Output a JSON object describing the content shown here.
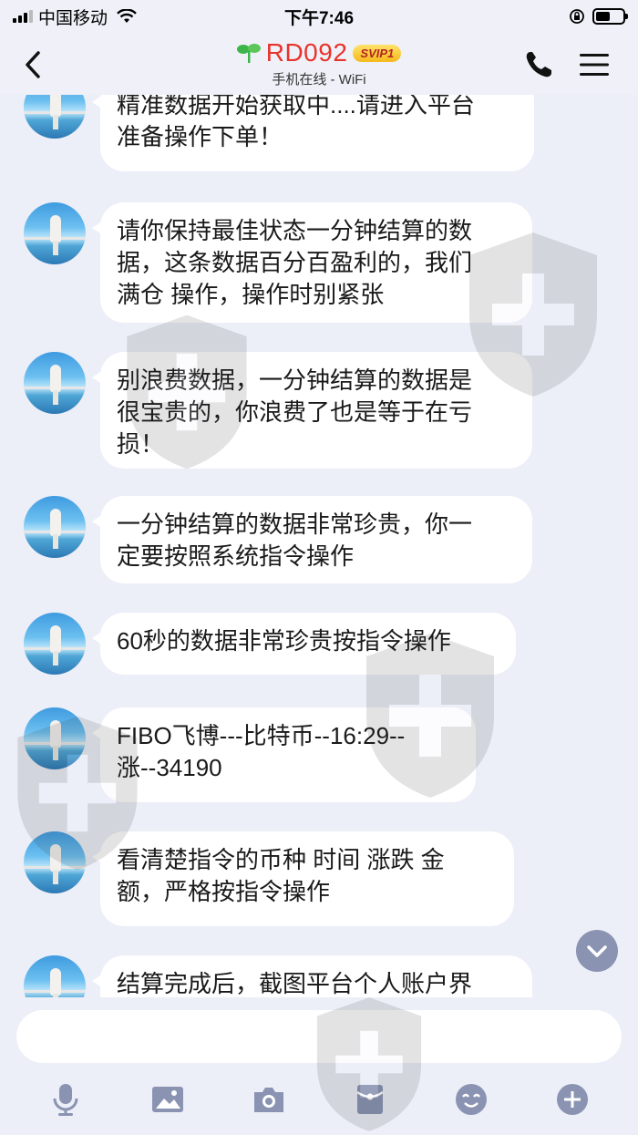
{
  "status_bar": {
    "carrier": "中国移动",
    "time": "下午7:46"
  },
  "header": {
    "title": "RD092",
    "badge": "SVIP1",
    "subtitle": "手机在线 - WiFi"
  },
  "messages": [
    {
      "text": "精准数据开始获取中....请进入平台\n准备操作下单！"
    },
    {
      "text": "请你保持最佳状态一分钟结算的数\n据，这条数据百分百盈利的，我们\n满仓 操作，操作时别紧张"
    },
    {
      "text": "别浪费数据，一分钟结算的数据是\n很宝贵的，你浪费了也是等于在亏\n损！"
    },
    {
      "text": "一分钟结算的数据非常珍贵，你一\n定要按照系统指令操作"
    },
    {
      "text": "60秒的数据非常珍贵按指令操作"
    },
    {
      "text": "FIBO飞博---比特币--16:29--\n涨--34190"
    },
    {
      "text": "看清楚指令的币种 时间  涨跌  金\n额，严格按指令操作"
    },
    {
      "text": "结算完成后，截图平台个人账户界"
    }
  ],
  "input": {
    "placeholder": ""
  },
  "icons": {
    "back": "chevron-left-icon",
    "call": "phone-icon",
    "menu": "hamburger-menu-icon",
    "scroll": "chevron-down-icon",
    "toolbar": [
      "microphone-icon",
      "image-icon",
      "camera-icon",
      "red-packet-icon",
      "emoji-icon",
      "plus-icon"
    ]
  },
  "colors": {
    "title": "#e8332b",
    "background": "#eceef8",
    "bubble": "#ffffff",
    "toolbar_icon": "#8a94b2"
  }
}
